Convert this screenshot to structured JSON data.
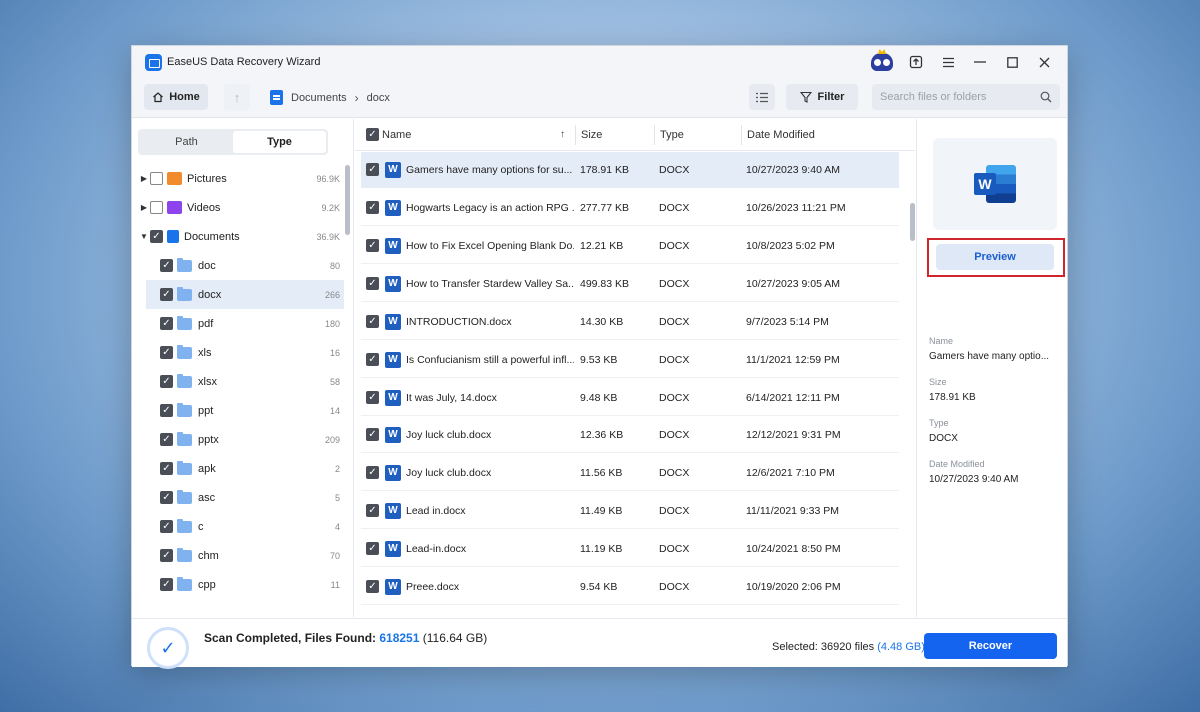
{
  "window": {
    "title": "EaseUS Data Recovery Wizard"
  },
  "titlebar_icons": [
    "owl-avatar-icon",
    "upgrade-icon",
    "menu-icon",
    "minimize-icon",
    "maximize-icon",
    "close-icon"
  ],
  "toolbar": {
    "home_label": "Home",
    "breadcrumb": [
      "Documents",
      "docx"
    ],
    "filter_label": "Filter",
    "search_placeholder": "Search files or folders"
  },
  "left_panel": {
    "tabs": [
      "Path",
      "Type"
    ],
    "active_tab": "Type",
    "categories": [
      {
        "label": "Pictures",
        "count": "96.9K",
        "checked": false,
        "expanded": false,
        "color": "#f28b2b"
      },
      {
        "label": "Videos",
        "count": "9.2K",
        "checked": false,
        "expanded": false,
        "color": "#8e44ec"
      },
      {
        "label": "Documents",
        "count": "36.9K",
        "checked": true,
        "expanded": true,
        "color": "#1a73e8"
      }
    ],
    "folders": [
      {
        "label": "doc",
        "count": "80",
        "selected": false
      },
      {
        "label": "docx",
        "count": "266",
        "selected": true
      },
      {
        "label": "pdf",
        "count": "180",
        "selected": false
      },
      {
        "label": "xls",
        "count": "16",
        "selected": false
      },
      {
        "label": "xlsx",
        "count": "58",
        "selected": false
      },
      {
        "label": "ppt",
        "count": "14",
        "selected": false
      },
      {
        "label": "pptx",
        "count": "209",
        "selected": false
      },
      {
        "label": "apk",
        "count": "2",
        "selected": false
      },
      {
        "label": "asc",
        "count": "5",
        "selected": false
      },
      {
        "label": "c",
        "count": "4",
        "selected": false
      },
      {
        "label": "chm",
        "count": "70",
        "selected": false
      },
      {
        "label": "cpp",
        "count": "11",
        "selected": false
      }
    ]
  },
  "file_list": {
    "columns": [
      "Name",
      "Size",
      "Type",
      "Date Modified"
    ],
    "rows": [
      {
        "name": "Gamers have many options for su...",
        "size": "178.91 KB",
        "type": "DOCX",
        "date": "10/27/2023 9:40 AM",
        "selected": true
      },
      {
        "name": "Hogwarts Legacy is an action RPG ...",
        "size": "277.77 KB",
        "type": "DOCX",
        "date": "10/26/2023 11:21 PM",
        "selected": false
      },
      {
        "name": "How to Fix Excel Opening Blank Do...",
        "size": "12.21 KB",
        "type": "DOCX",
        "date": "10/8/2023 5:02 PM",
        "selected": false
      },
      {
        "name": "How to Transfer Stardew Valley Sa...",
        "size": "499.83 KB",
        "type": "DOCX",
        "date": "10/27/2023 9:05 AM",
        "selected": false
      },
      {
        "name": "INTRODUCTION.docx",
        "size": "14.30 KB",
        "type": "DOCX",
        "date": "9/7/2023 5:14 PM",
        "selected": false
      },
      {
        "name": "Is Confucianism still a powerful infl...",
        "size": "9.53 KB",
        "type": "DOCX",
        "date": "11/1/2021 12:59 PM",
        "selected": false
      },
      {
        "name": "It was July, 14.docx",
        "size": "9.48 KB",
        "type": "DOCX",
        "date": "6/14/2021 12:11 PM",
        "selected": false
      },
      {
        "name": "Joy luck club.docx",
        "size": "12.36 KB",
        "type": "DOCX",
        "date": "12/12/2021 9:31 PM",
        "selected": false
      },
      {
        "name": "Joy luck club.docx",
        "size": "11.56 KB",
        "type": "DOCX",
        "date": "12/6/2021 7:10 PM",
        "selected": false
      },
      {
        "name": "Lead in.docx",
        "size": "11.49 KB",
        "type": "DOCX",
        "date": "11/11/2021 9:33 PM",
        "selected": false
      },
      {
        "name": "Lead-in.docx",
        "size": "11.19 KB",
        "type": "DOCX",
        "date": "10/24/2021 8:50 PM",
        "selected": false
      },
      {
        "name": "Preee.docx",
        "size": "9.54 KB",
        "type": "DOCX",
        "date": "10/19/2020 2:06 PM",
        "selected": false
      }
    ]
  },
  "preview_panel": {
    "button_label": "Preview",
    "name_label": "Name",
    "name_value": "Gamers have many optio...",
    "size_label": "Size",
    "size_value": "178.91 KB",
    "type_label": "Type",
    "type_value": "DOCX",
    "date_label": "Date Modified",
    "date_value": "10/27/2023 9:40 AM"
  },
  "status": {
    "scan_label": "Scan Completed, Files Found: ",
    "files_found": "618251",
    "total_size": "(116.64 GB)",
    "selected_label": "Selected: 36920 files ",
    "selected_size": "(4.48 GB)",
    "recover_label": "Recover"
  },
  "colors": {
    "accent": "#1464f0",
    "highlight": "#d0252a",
    "selection": "#e4ecf8"
  }
}
